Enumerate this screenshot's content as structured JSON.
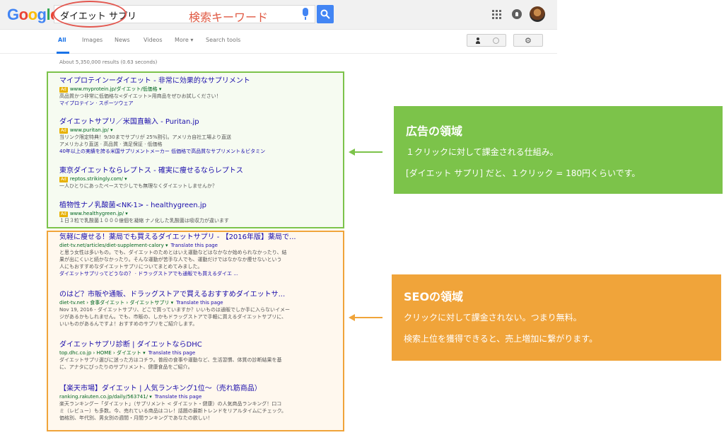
{
  "logo": {
    "g1": "G",
    "o1": "o",
    "o2": "o",
    "g2": "g",
    "l": "l",
    "e": "e"
  },
  "search": {
    "query": "ダイエット サプリ",
    "annotation": "検索キーワード"
  },
  "tabs": [
    "All",
    "Images",
    "News",
    "Videos",
    "More ▾",
    "Search tools"
  ],
  "stats": "About 5,350,000 results (0.63 seconds)",
  "ads": [
    {
      "title": "マイプロテインーダイエット - 非常に効果的なサプリメント",
      "url": "www.myprotein.jp/ダイエット/低価格 ▾",
      "snippets": [
        "高品質かつ非常に低価格な<ダイエット>用商品をぜひお試しください！"
      ],
      "sitelinks": "マイプロテイン · スポーツウェア"
    },
    {
      "title": "ダイエットサプリ／米国直輸入 - Puritan.jp",
      "url": "www.puritan.jp/ ▾",
      "snippets": [
        "当リンク限定特典！9/30までサプリが 25%割引。アメリカ自社工場より直送",
        "アメリカより直送 · 高品質 · 満足保証 · 低価格"
      ],
      "sitelinks": "40年以上の実績を誇る米国サプリメントメーカー 低価格で高品質なサプリメント＆ビタミン"
    },
    {
      "title": "東京ダイエットならレプトス - 確実に痩せるならレプトス",
      "url": "reptos.strikingly.com/ ▾",
      "snippets": [
        "一人ひとりにあったペースで少しでも無理なくダイエットしませんか？"
      ],
      "sitelinks": ""
    },
    {
      "title": "植物性ナノ乳酸菌<NK-1> - healthygreen.jp",
      "url": "www.healthygreen.jp/ ▾",
      "snippets": [
        "１日３粒で乳酸菌１０００億個を凝縮 ナノ化した乳酸菌は吸収力が違います"
      ],
      "sitelinks": ""
    }
  ],
  "organic": [
    {
      "title": "気軽に痩せる！薬局でも買えるダイエットサプリ - 【2016年版】薬局で...",
      "url": "diet-tv.net/articles/diet-supplement-calory ▾",
      "translate": "Translate this page",
      "snippets": [
        "と思う女性は多いもの。でも、ダイエットのためとはいえ運動などはなかなか始められなかったり、結",
        "果が出にくいと続かなかったり。そんな運動が苦手な人でも、運動だけではなかなか痩せないという",
        "人にもおすすめなダイエットサプリについてまとめてみました。"
      ],
      "sitelinks": "ダイエットサプリってどうなの？ · ドラッグストアでも通販でも買えるダイエ ..."
    },
    {
      "title": "のはど？市販や通販、ドラッグストアで買えるおすすめダイエットサ...",
      "url": "diet-tv.net › 食事ダイエット › ダイエットサプリ ▾",
      "translate": "Translate this page",
      "snippets": [
        "Nov 19, 2016 - ダイエットサプリ、どこで買っていますか？いいものは通販でしか手に入らないイメー",
        "ジがあるかもしれません。でも、市販の、しかもドラッグストアで手軽に買えるダイエットサプリに、",
        "いいものがあるんですよ！おすすめのサプリをご紹介します。"
      ],
      "sitelinks": ""
    },
    {
      "title": "ダイエットサプリ診断 | ダイエットならDHC",
      "url": "top.dhc.co.jp › HOME › ダイエット ▾",
      "translate": "Translate this page",
      "snippets": [
        "ダイエットサプリ選びに迷った方はコチラ。普段の食事や運動など、生活習慣、体質の診断結果を基",
        "に、アナタにぴったりのサプリメント、健康食品をご紹介。"
      ],
      "sitelinks": ""
    },
    {
      "title": "【楽天市場】ダイエット | 人気ランキング1位〜（売れ筋商品）",
      "url": "ranking.rakuten.co.jp/daily/563741/ ▾",
      "translate": "Translate this page",
      "snippets": [
        "楽天ランキングー「ダイエット」（サプリメント < ダイエット・健康）の人気商品ランキング！口コ",
        "ミ（レビュー）も多数。今、売れている商品はコレ！話題の最新トレンドをリアルタイムにチェック。",
        "価格別、年代別、男女別の週間・月間ランキングであなたの欲しい！"
      ],
      "sitelinks": ""
    }
  ],
  "callout_ad": {
    "title": "広告の領域",
    "line1": "１クリックに対して課金される仕組み。",
    "line2": "[ダイエット サプリ] だと、１クリック = 180円くらいです。"
  },
  "callout_seo": {
    "title": "SEOの領域",
    "line1": "クリックに対して課金されない。つまり無料。",
    "line2": "検索上位を獲得できると、売上増加に繋がります。"
  },
  "colors": {
    "ad_green": "#7cc34a",
    "seo_orange": "#f0a43a",
    "link_blue": "#1a0dab",
    "url_green": "#006621"
  }
}
